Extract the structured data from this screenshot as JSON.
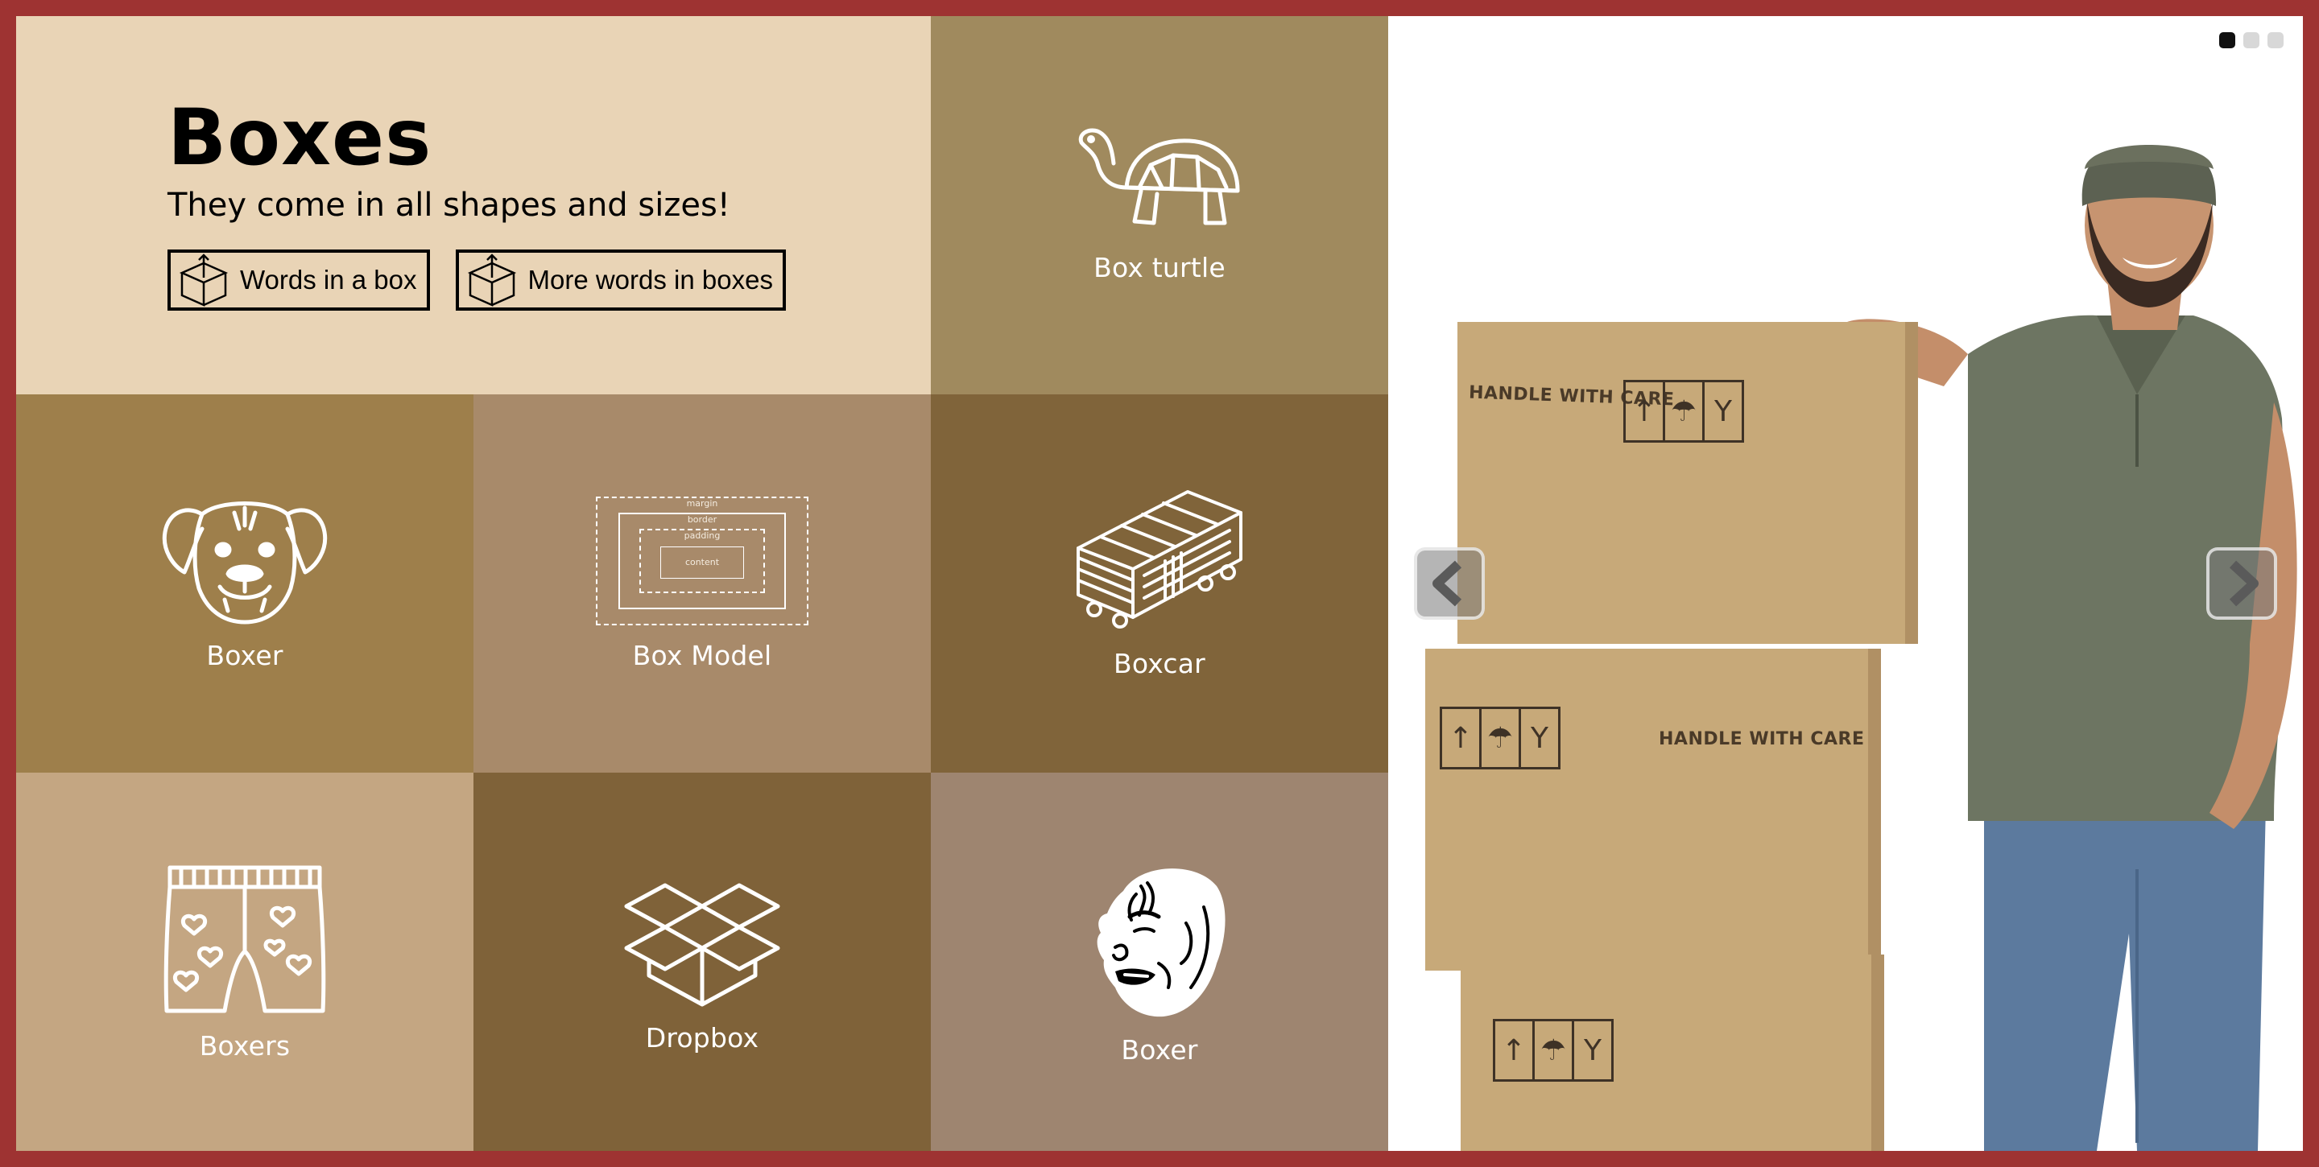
{
  "header": {
    "title": "Boxes",
    "tagline": "They come in all shapes and sizes!",
    "buttons": [
      {
        "label": "Words in a box",
        "icon": "box-icon"
      },
      {
        "label": "More words in boxes",
        "icon": "box-icon"
      }
    ],
    "background": "#e9d4b6"
  },
  "tiles": [
    {
      "label": "Box turtle",
      "icon": "turtle-icon",
      "color": "#a08a5e"
    },
    {
      "label": "Boxer",
      "icon": "boxer-dog-icon",
      "color": "#9e7f4b"
    },
    {
      "label": "Box Model",
      "icon": "box-model-icon",
      "color": "#a88a6a"
    },
    {
      "label": "Boxcar",
      "icon": "boxcar-icon",
      "color": "#80643a"
    },
    {
      "label": "Boxers",
      "icon": "boxers-shorts-icon",
      "color": "#c4a682"
    },
    {
      "label": "Dropbox",
      "icon": "dropbox-icon",
      "color": "#7f6239"
    },
    {
      "label": "Boxer",
      "icon": "boxer-face-icon",
      "color": "#9e8570"
    }
  ],
  "box_model": {
    "margin": "margin",
    "border": "border",
    "padding": "padding",
    "content": "content"
  },
  "carousel": {
    "slide_count": 3,
    "active_slide": 1,
    "prev_icon": "chevron-left-icon",
    "next_icon": "chevron-right-icon",
    "box_text": "HANDLE WITH CARE",
    "box_symbols": [
      "↑",
      "☂",
      "Y"
    ]
  },
  "colors": {
    "frame": "#9e3332",
    "box": "#c7a979",
    "shirt": "#6d7562",
    "jeans": "#5c7a9e"
  }
}
